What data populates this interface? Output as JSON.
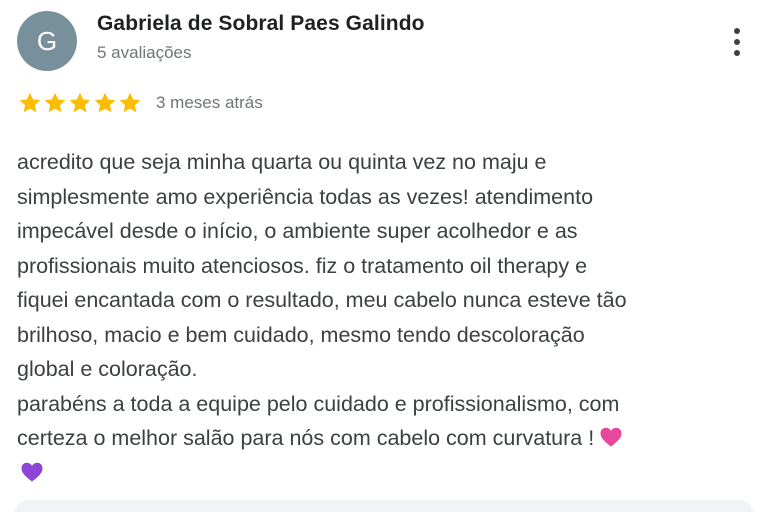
{
  "review": {
    "avatar_letter": "G",
    "author_name": "Gabriela de Sobral Paes Galindo",
    "review_count": "5 avaliações",
    "rating": 5,
    "rating_max": 5,
    "time_ago": "3 meses atrás",
    "text_lines": [
      "acredito que seja minha quarta ou quinta vez no maju e",
      "simplesmente amo experiência todas as vezes! atendimento",
      "impecável desde o início, o ambiente super acolhedor e as",
      "profissionais muito atenciosos. fiz o tratamento oil therapy e",
      "fiquei encantada com o resultado, meu cabelo nunca esteve tão",
      "brilhoso, macio e bem cuidado, mesmo tendo descoloração",
      "global e coloração.",
      "parabéns a toda a equipe pelo cuidado e profissionalismo, com",
      "certeza o melhor salão para nós com cabelo com curvatura !"
    ],
    "emojis": [
      "pink-heart-emoji",
      "purple-heart-emoji"
    ],
    "more_options_icon": "more-vertical-icon"
  },
  "colors": {
    "avatar_bg": "#78909c",
    "star": "#fbbc04",
    "author": "#202124",
    "meta": "#70757a",
    "body_text": "#3c4043",
    "pink_heart": "#e8489a",
    "purple_heart": "#8e44d6"
  }
}
